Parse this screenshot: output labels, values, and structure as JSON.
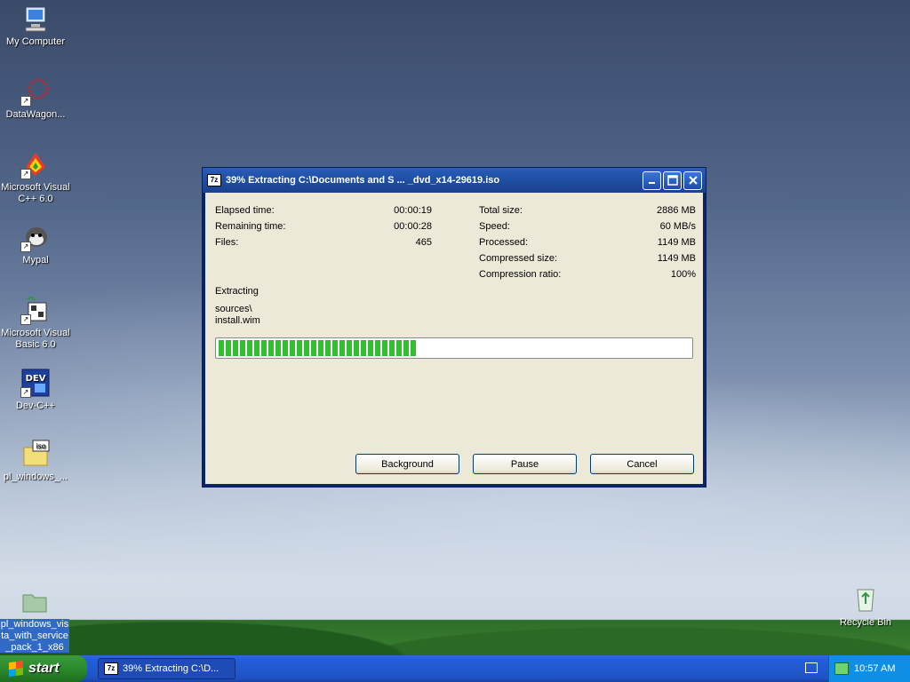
{
  "desktop": {
    "icons": [
      {
        "label": "My Computer",
        "icon": "computer-icon"
      },
      {
        "label": "DataWagon...",
        "icon": "datawagon-icon"
      },
      {
        "label": "Microsoft Visual C++ 6.0",
        "icon": "visual-cpp-icon"
      },
      {
        "label": "Mypal",
        "icon": "mypal-icon"
      },
      {
        "label": "Microsoft Visual Basic 6.0",
        "icon": "visual-basic-icon"
      },
      {
        "label": "Dev-C++",
        "icon": "devcpp-icon"
      },
      {
        "label": "pl_windows_...",
        "icon": "iso-file-icon"
      },
      {
        "label": "pl_windows_vista_with_service_pack_1_x86",
        "icon": "folder-icon"
      },
      {
        "label": "Recycle Bin",
        "icon": "recycle-bin-icon"
      }
    ]
  },
  "dialog": {
    "title": "39% Extracting C:\\Documents and S ... _dvd_x14-29619.iso",
    "app_icon_text": "7z",
    "left_stats": [
      {
        "label": "Elapsed time:",
        "value": "00:00:19"
      },
      {
        "label": "Remaining time:",
        "value": "00:00:28"
      },
      {
        "label": "Files:",
        "value": "465"
      }
    ],
    "right_stats": [
      {
        "label": "Total size:",
        "value": "2886 MB"
      },
      {
        "label": "Speed:",
        "value": "60 MB/s"
      },
      {
        "label": "Processed:",
        "value": "1149 MB"
      },
      {
        "label": "Compressed size:",
        "value": "1149 MB"
      },
      {
        "label": "Compression ratio:",
        "value": "100%"
      }
    ],
    "status_label": "Extracting",
    "current_path": "sources\\",
    "current_file": "install.wim",
    "progress_percent": 39,
    "buttons": {
      "background": "Background",
      "pause": "Pause",
      "cancel": "Cancel"
    }
  },
  "taskbar": {
    "start_label": "start",
    "task_label": "39% Extracting C:\\D...",
    "task_icon_text": "7z",
    "clock": "10:57 AM"
  },
  "colors": {
    "progress_fill": "#2fbf2f",
    "title_bar": "#1f4ea3",
    "taskbar": "#245edb"
  }
}
